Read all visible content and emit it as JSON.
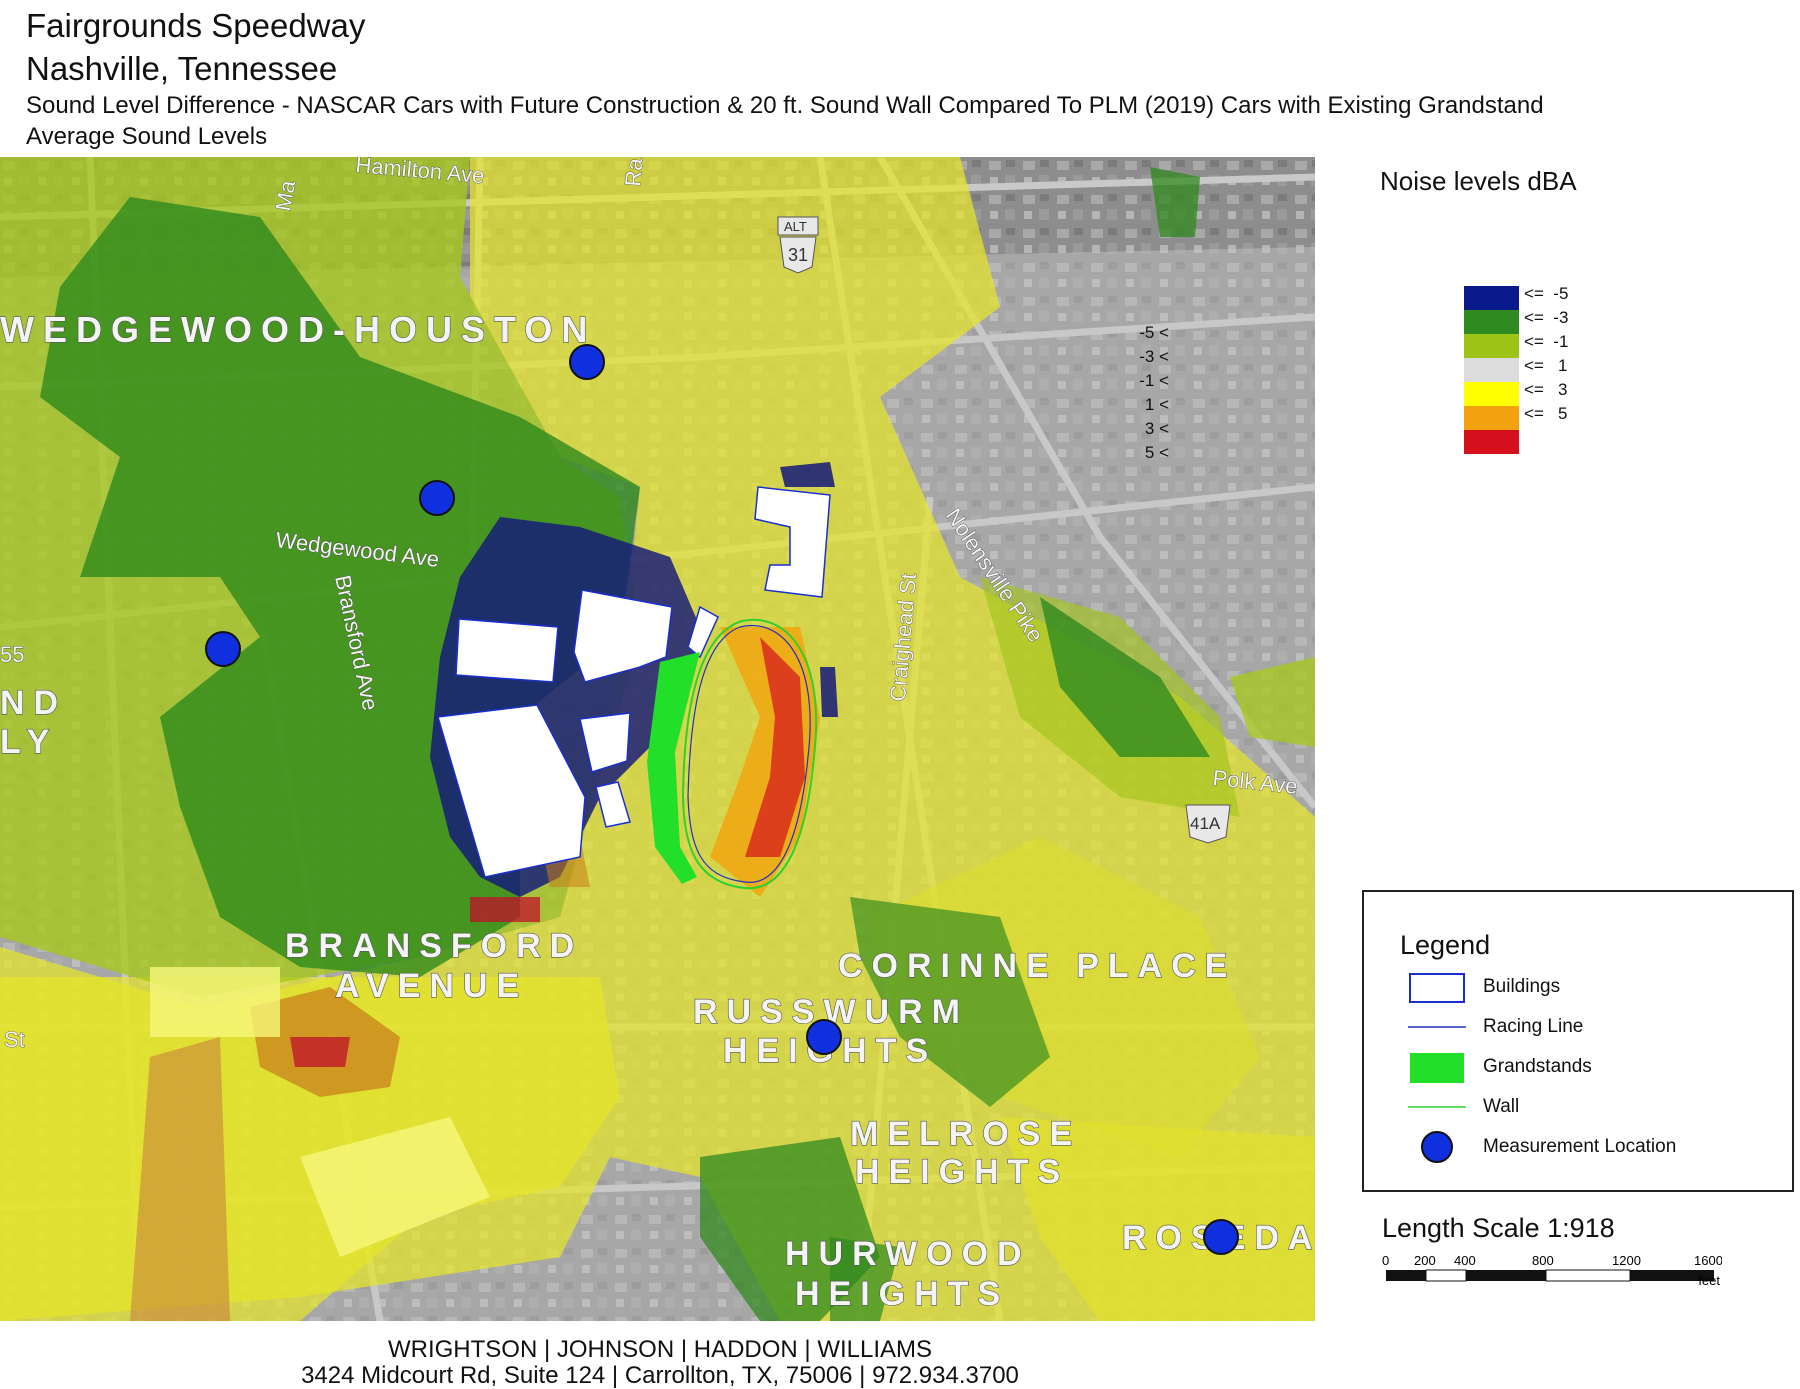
{
  "title": {
    "line1": "Fairgrounds Speedway",
    "line2": "Nashville, Tennessee",
    "line3": "Sound Level Difference - NASCAR Cars with Future Construction & 20 ft. Sound Wall Compared To PLM (2019) Cars with Existing Grandstand",
    "line4": "Average Sound Levels"
  },
  "map": {
    "neighborhoods": [
      "WEDGEWOOD-HOUSTON",
      "BRANSFORD",
      "AVENUE",
      "CORINNE PLACE",
      "RUSSWURM",
      "HEIGHTS",
      "MELROSE",
      "HEIGHTS",
      "HURWOOD",
      "HEIGHTS",
      "ROSEDA",
      "ND",
      "LY"
    ],
    "roads": [
      "Hamilton Ave",
      "Wedgewood Ave",
      "Bransford Ave",
      "Craighead St",
      "Nolensville Pike",
      "Polk Ave",
      "St",
      "Ma",
      "Ra",
      "55"
    ],
    "shields": [
      "ALT",
      "31",
      "41A"
    ]
  },
  "noise_scale": {
    "title": "Noise levels dBA",
    "rows": [
      {
        "lower": "",
        "upper": "<=  -5",
        "color": "#0b1a8a"
      },
      {
        "lower": "-5 <",
        "upper": "<=  -3",
        "color": "#2f8a1f"
      },
      {
        "lower": "-3 <",
        "upper": "<=  -1",
        "color": "#9cc316"
      },
      {
        "lower": "-1 <",
        "upper": "<=   1",
        "color": "#dcdcdc"
      },
      {
        "lower": "1 <",
        "upper": "<=   3",
        "color": "#ffff00"
      },
      {
        "lower": "3 <",
        "upper": "<=   5",
        "color": "#f2a20c"
      },
      {
        "lower": "5 <",
        "upper": "",
        "color": "#d4101c"
      }
    ]
  },
  "legend": {
    "title": "Legend",
    "items": [
      {
        "label": "Buildings",
        "symbol": "white box with blue outline"
      },
      {
        "label": "Racing Line",
        "symbol": "blue line"
      },
      {
        "label": "Grandstands",
        "symbol": "bright green box"
      },
      {
        "label": "Wall",
        "symbol": "green line"
      },
      {
        "label": "Measurement Location",
        "symbol": "blue circle"
      }
    ]
  },
  "length_scale": {
    "label": "Length Scale 1:918",
    "ticks": [
      "0",
      "200",
      "400",
      "800",
      "1200",
      "1600"
    ],
    "unit": "feet"
  },
  "footer": {
    "line1": "WRIGHTSON | JOHNSON | HADDON | WILLIAMS",
    "line2": "3424 Midcourt Rd, Suite 124 | Carrollton, TX, 75006 | 972.934.3700"
  },
  "colors": {
    "buildings_outline": "#1a2fd0",
    "grandstands": "#22e02a",
    "measurement": "#1030e0",
    "wall": "#2dd02d",
    "racing_line": "#2030c0"
  }
}
